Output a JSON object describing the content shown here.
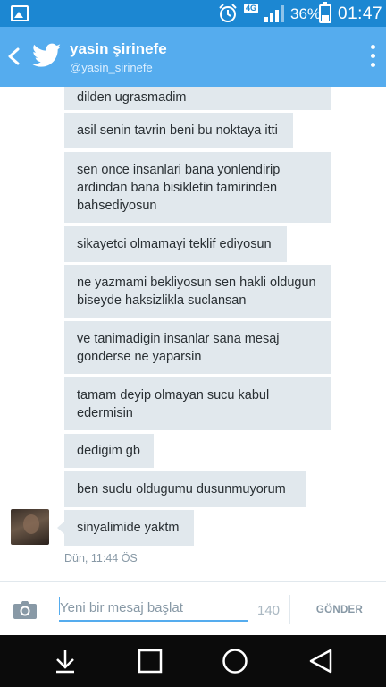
{
  "status_bar": {
    "network": "4G",
    "battery_percent": "36%",
    "battery_level": 0.36,
    "time": "01:47"
  },
  "header": {
    "name": "yasin şirinefe",
    "handle": "@yasin_sirinefe"
  },
  "messages": [
    {
      "text": "dilden ugrasmadim"
    },
    {
      "text": "asil senin tavrin beni bu noktaya itti"
    },
    {
      "text": "sen once insanlari bana yonlendirip ardindan bana bisikletin tamirinden bahsediyosun"
    },
    {
      "text": "sikayetci olmamayi teklif ediyosun"
    },
    {
      "text": "ne yazmami bekliyosun sen hakli oldugun biseyde haksizlikla suclansan"
    },
    {
      "text": "ve tanimadigin insanlar sana mesaj gonderse ne yaparsin"
    },
    {
      "text": "tamam deyip olmayan sucu kabul edermisin"
    },
    {
      "text": "dedigim gb"
    },
    {
      "text": "ben suclu oldugumu dusunmuyorum"
    },
    {
      "text": "sinyalimide yaktm"
    }
  ],
  "last_timestamp": "Dün, 11:44 ÖS",
  "compose": {
    "placeholder": "Yeni bir mesaj başlat",
    "counter": "140",
    "send_label": "GÖNDER"
  },
  "icons": {
    "status_left": "gallery-icon",
    "alarm": "alarm-icon",
    "signal": "signal-icon",
    "battery": "battery-icon",
    "back": "back-icon",
    "logo": "twitter-bird-icon",
    "more": "more-vertical-icon",
    "camera": "camera-icon",
    "nav_back": "nav-back-icon",
    "nav_home": "nav-home-icon",
    "nav_recents": "nav-recents-icon",
    "nav_notifications": "nav-notifications-icon"
  },
  "colors": {
    "status_bar": "#1c87d2",
    "app_bar": "#55acee",
    "bubble": "#e1e8ed",
    "nav_bar": "#0b0b0b"
  }
}
